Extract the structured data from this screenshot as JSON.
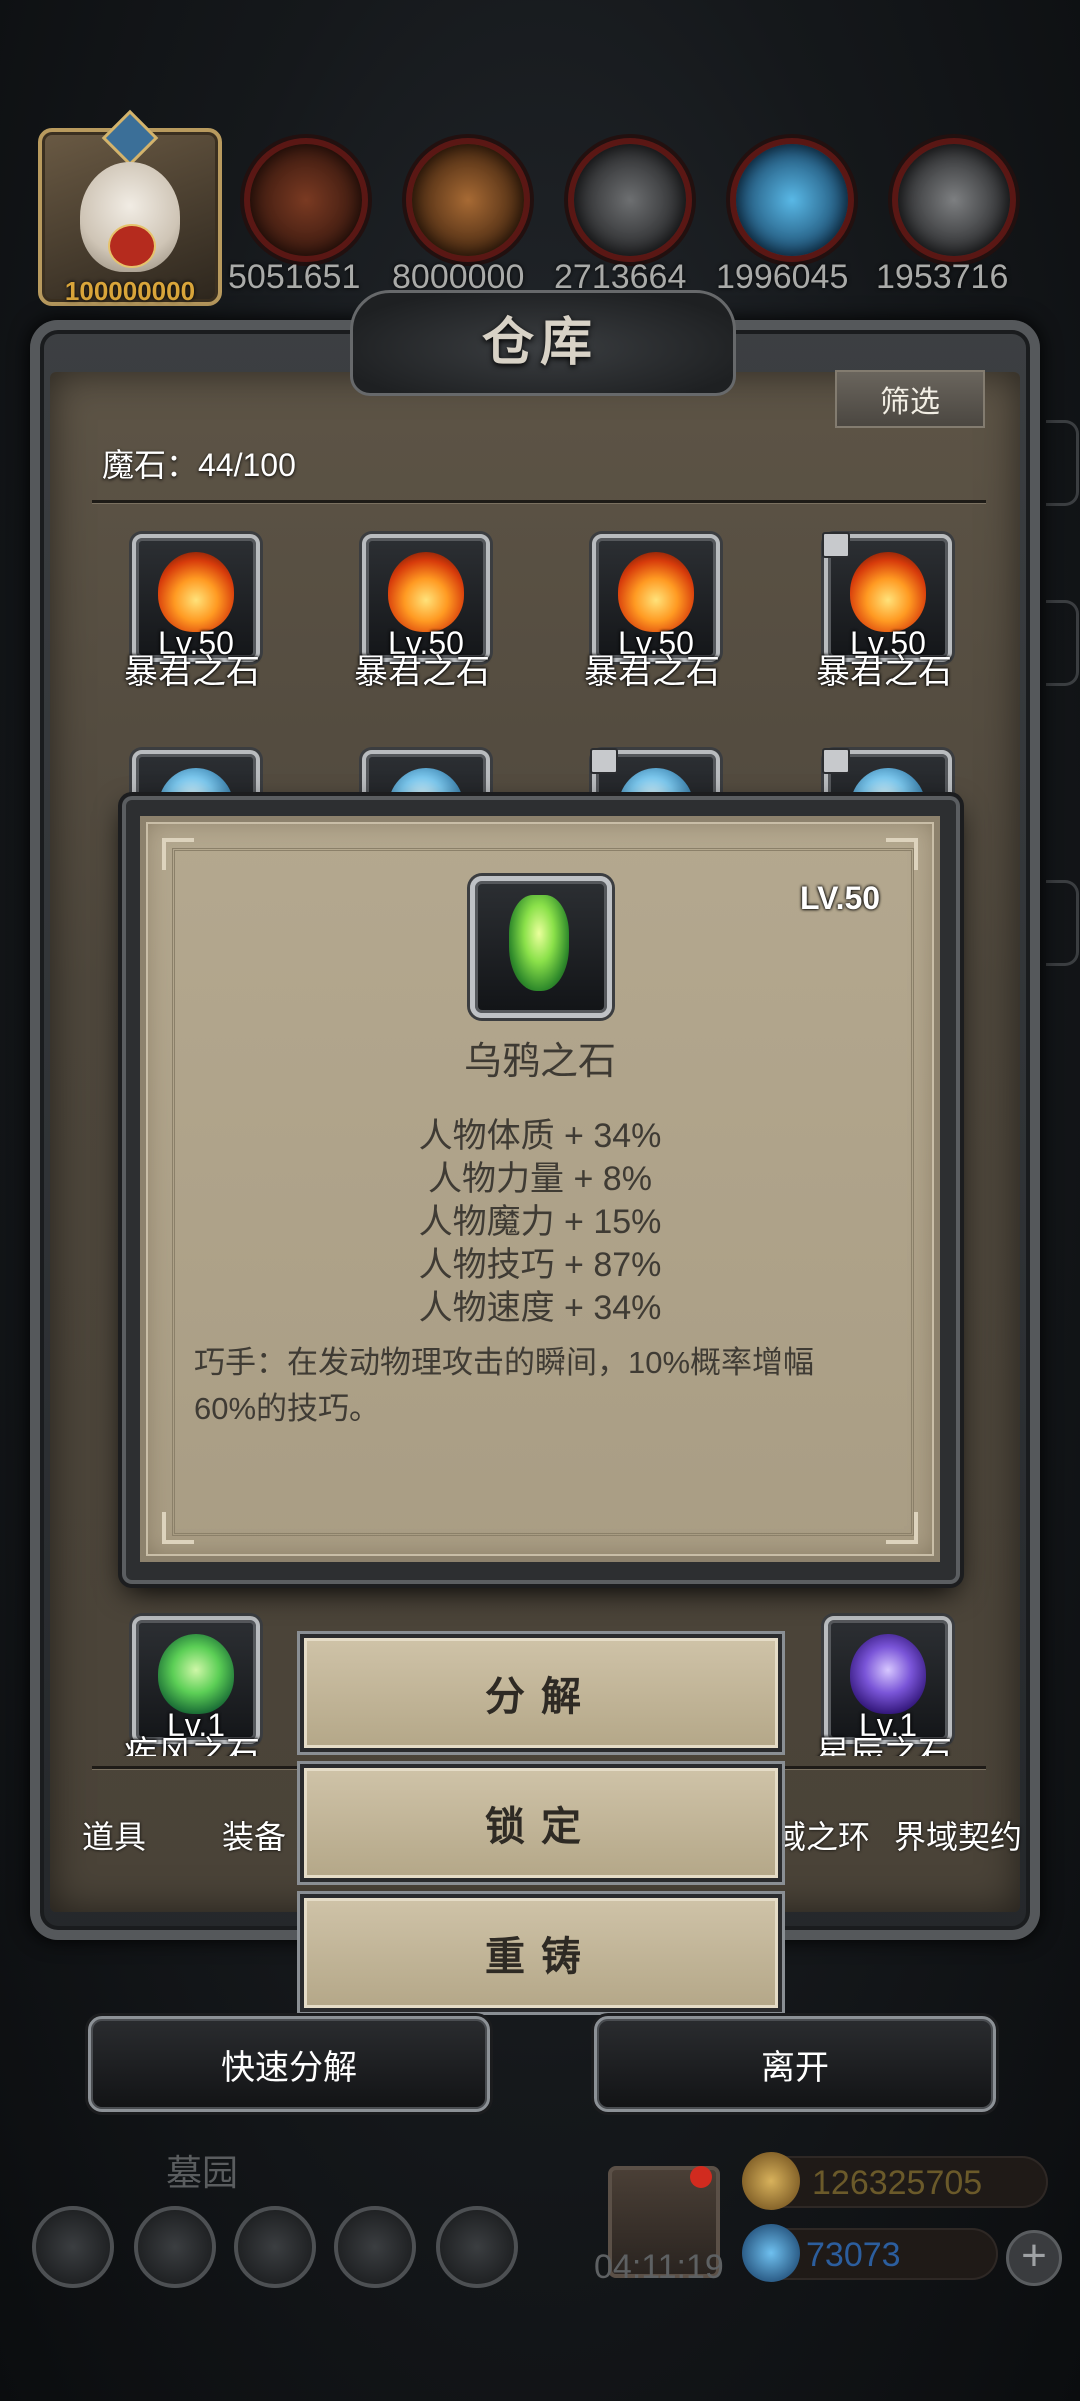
{
  "header": {
    "avatar_value": "100000000",
    "resources": [
      {
        "icon": "meat-icon",
        "value": "5051651"
      },
      {
        "icon": "wood-icon",
        "value": "8000000"
      },
      {
        "icon": "iron-icon",
        "value": "2713664"
      },
      {
        "icon": "crystal-icon",
        "value": "1996045"
      },
      {
        "icon": "stone-icon",
        "value": "1953716"
      }
    ]
  },
  "warehouse": {
    "title": "仓库",
    "filter_label": "筛选",
    "stone_count": "魔石：44/100",
    "row1": [
      {
        "level": "Lv.50",
        "name": "暴君之石",
        "locked": false
      },
      {
        "level": "Lv.50",
        "name": "暴君之石",
        "locked": false
      },
      {
        "level": "Lv.50",
        "name": "暴君之石",
        "locked": false
      },
      {
        "level": "Lv.50",
        "name": "暴君之石",
        "locked": true
      }
    ],
    "row_bottom": [
      {
        "level": "Lv.1",
        "name": "疾风之石"
      },
      {
        "level": "Lv.1",
        "name": "星辰之石"
      }
    ],
    "tabs": [
      "道具",
      "装备",
      "域之环",
      "界域契约"
    ]
  },
  "popup": {
    "level": "LV.50",
    "name": "乌鸦之石",
    "stats": [
      "人物体质 + 34%",
      "人物力量 + 8%",
      "人物魔力 + 15%",
      "人物技巧 + 87%",
      "人物速度 + 34%"
    ],
    "description": "巧手：在发动物理攻击的瞬间，10%概率增幅60%的技巧。"
  },
  "actions": {
    "decompose": "分解",
    "lock": "锁定",
    "reforge": "重铸"
  },
  "footer": {
    "quick_decompose": "快速分解",
    "leave": "离开",
    "grave": "墓园",
    "timer": "04:11:19",
    "gold": "126325705",
    "gems": "73073"
  },
  "colors": {
    "gold_text": "#6b5a2a",
    "gem_text": "#2c5e9e",
    "avatar_value": "#d9a53a"
  }
}
